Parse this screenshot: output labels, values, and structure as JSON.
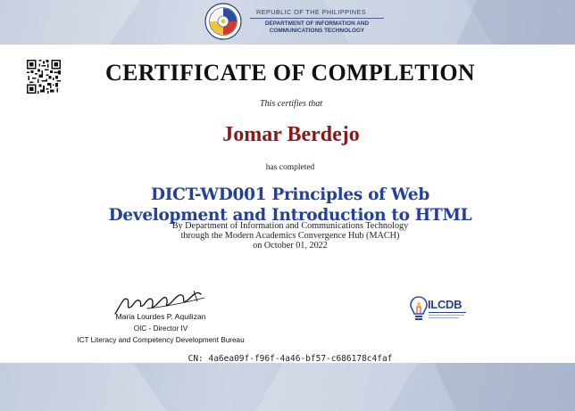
{
  "header": {
    "republic": "REPUBLIC OF THE PHILIPPINES",
    "department_line1": "DEPARTMENT OF INFORMATION AND",
    "department_line2": "COMMUNICATIONS TECHNOLOGY",
    "seal_icon": "dict-seal-icon"
  },
  "certificate": {
    "title": "CERTIFICATE OF COMPLETION",
    "certifies": "This certifies that",
    "recipient": "Jomar Berdejo",
    "has_completed": "has completed",
    "course_line1": "DICT-WD001 Principles of Web",
    "course_line2": "Development and Introduction to HTML",
    "by_line": "By Department of Information and Communications Technology",
    "through_line": "through the Modern Academics Convergence Hub (MACH)",
    "date_line": "on October 01, 2022"
  },
  "signatory": {
    "name": "Maria Lourdes P. Aquilizan",
    "position": "OIC - Director IV",
    "office": "ICT Literacy and Competency Development Bureau"
  },
  "logo": {
    "ilcdb_text": "ILCDB",
    "icon": "lightbulb-icon"
  },
  "footer": {
    "cn": "CN: 4a6ea09f-f96f-4a46-bf57-c686178c4faf"
  },
  "colors": {
    "title": "#111111",
    "recipient": "#8b1818",
    "course": "#23409a",
    "band": "#c6cfe0"
  }
}
